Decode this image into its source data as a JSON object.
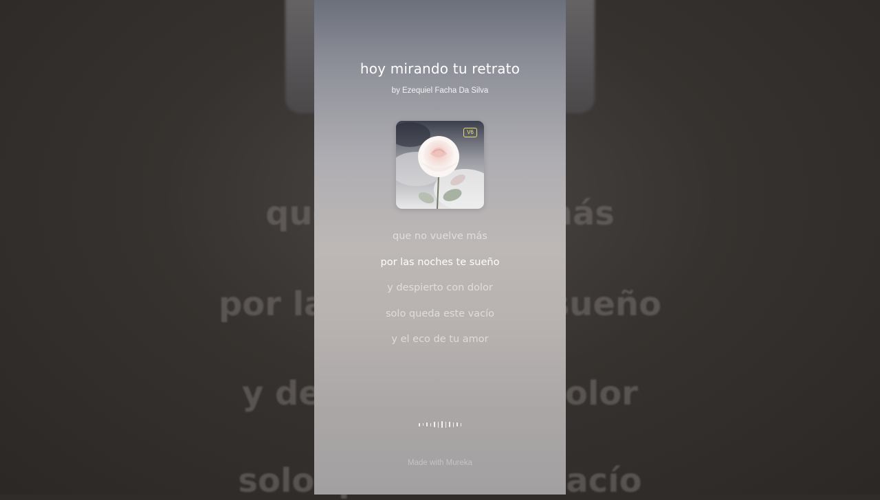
{
  "song": {
    "title": "hoy mirando tu retrato",
    "artist": "by Ezequiel Facha Da Silva",
    "badge": "V6",
    "artwork_icon": "rose-artwork"
  },
  "lyrics": [
    {
      "text": "que no vuelve más",
      "active": false
    },
    {
      "text": "por las noches te sueño",
      "active": true
    },
    {
      "text": "y despierto con dolor",
      "active": false
    },
    {
      "text": "solo queda este vacío",
      "active": false
    },
    {
      "text": "y el eco de tu amor",
      "active": false
    }
  ],
  "background_lyrics": [
    "que no vuelve más",
    "por las noches te sueño",
    "y despierto con dolor",
    "solo queda este vacío"
  ],
  "waveform_icon": "audio-waveform-icon",
  "footer": "Made with Mureka",
  "colors": {
    "badge": "#e8e16a",
    "active_lyric": "#ffffff",
    "inactive_lyric": "rgba(255,255,255,0.55)"
  }
}
